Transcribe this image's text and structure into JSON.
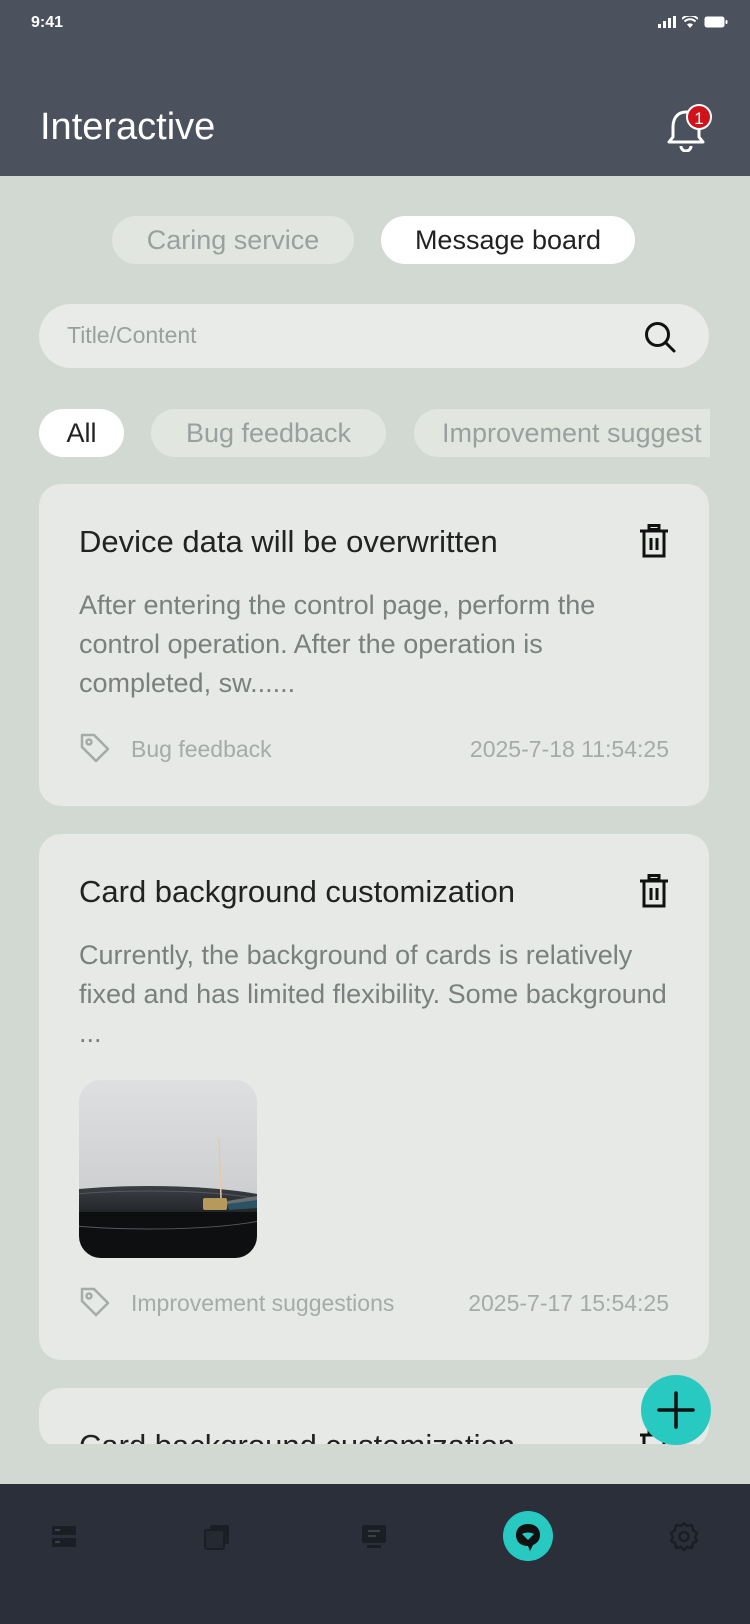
{
  "status_bar": {
    "time": "9:41"
  },
  "header": {
    "title": "Interactive",
    "notification_count": "1"
  },
  "tabs": [
    {
      "label": "Caring service",
      "active": false
    },
    {
      "label": "Message board",
      "active": true
    }
  ],
  "search": {
    "placeholder": "Title/Content"
  },
  "filters": [
    {
      "label": "All",
      "active": true
    },
    {
      "label": "Bug feedback",
      "active": false
    },
    {
      "label": "Improvement suggest",
      "active": false
    }
  ],
  "posts": [
    {
      "title": "Device data will be overwritten",
      "body": "After entering the control page, perform the control operation. After the operation is completed, sw......",
      "tag": "Bug feedback",
      "timestamp": "2025-7-18 11:54:25"
    },
    {
      "title": "Card background customization",
      "body": "Currently, the background of cards is relatively fixed and has limited flexibility. Some background ...",
      "tag": "Improvement suggestions",
      "timestamp": "2025-7-17 15:54:25",
      "has_image": true
    },
    {
      "title": "Card background customization"
    }
  ],
  "nav": {
    "items": [
      "devices-icon",
      "scenes-icon",
      "monitor-icon",
      "message-icon",
      "settings-icon"
    ],
    "active_index": 3
  },
  "colors": {
    "header_bg": "#4b525d",
    "accent": "#27c9c0",
    "page_bg": "#d2d9d2",
    "badge": "#d0131b",
    "tabbar_bg": "#2b2f39"
  }
}
